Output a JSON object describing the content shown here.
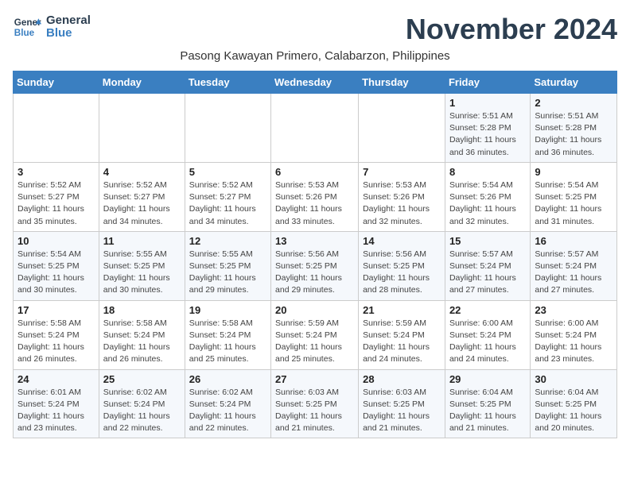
{
  "logo": {
    "line1": "General",
    "line2": "Blue"
  },
  "title": "November 2024",
  "subtitle": "Pasong Kawayan Primero, Calabarzon, Philippines",
  "headers": [
    "Sunday",
    "Monday",
    "Tuesday",
    "Wednesday",
    "Thursday",
    "Friday",
    "Saturday"
  ],
  "weeks": [
    [
      {
        "day": "",
        "info": ""
      },
      {
        "day": "",
        "info": ""
      },
      {
        "day": "",
        "info": ""
      },
      {
        "day": "",
        "info": ""
      },
      {
        "day": "",
        "info": ""
      },
      {
        "day": "1",
        "info": "Sunrise: 5:51 AM\nSunset: 5:28 PM\nDaylight: 11 hours\nand 36 minutes."
      },
      {
        "day": "2",
        "info": "Sunrise: 5:51 AM\nSunset: 5:28 PM\nDaylight: 11 hours\nand 36 minutes."
      }
    ],
    [
      {
        "day": "3",
        "info": "Sunrise: 5:52 AM\nSunset: 5:27 PM\nDaylight: 11 hours\nand 35 minutes."
      },
      {
        "day": "4",
        "info": "Sunrise: 5:52 AM\nSunset: 5:27 PM\nDaylight: 11 hours\nand 34 minutes."
      },
      {
        "day": "5",
        "info": "Sunrise: 5:52 AM\nSunset: 5:27 PM\nDaylight: 11 hours\nand 34 minutes."
      },
      {
        "day": "6",
        "info": "Sunrise: 5:53 AM\nSunset: 5:26 PM\nDaylight: 11 hours\nand 33 minutes."
      },
      {
        "day": "7",
        "info": "Sunrise: 5:53 AM\nSunset: 5:26 PM\nDaylight: 11 hours\nand 32 minutes."
      },
      {
        "day": "8",
        "info": "Sunrise: 5:54 AM\nSunset: 5:26 PM\nDaylight: 11 hours\nand 32 minutes."
      },
      {
        "day": "9",
        "info": "Sunrise: 5:54 AM\nSunset: 5:25 PM\nDaylight: 11 hours\nand 31 minutes."
      }
    ],
    [
      {
        "day": "10",
        "info": "Sunrise: 5:54 AM\nSunset: 5:25 PM\nDaylight: 11 hours\nand 30 minutes."
      },
      {
        "day": "11",
        "info": "Sunrise: 5:55 AM\nSunset: 5:25 PM\nDaylight: 11 hours\nand 30 minutes."
      },
      {
        "day": "12",
        "info": "Sunrise: 5:55 AM\nSunset: 5:25 PM\nDaylight: 11 hours\nand 29 minutes."
      },
      {
        "day": "13",
        "info": "Sunrise: 5:56 AM\nSunset: 5:25 PM\nDaylight: 11 hours\nand 29 minutes."
      },
      {
        "day": "14",
        "info": "Sunrise: 5:56 AM\nSunset: 5:25 PM\nDaylight: 11 hours\nand 28 minutes."
      },
      {
        "day": "15",
        "info": "Sunrise: 5:57 AM\nSunset: 5:24 PM\nDaylight: 11 hours\nand 27 minutes."
      },
      {
        "day": "16",
        "info": "Sunrise: 5:57 AM\nSunset: 5:24 PM\nDaylight: 11 hours\nand 27 minutes."
      }
    ],
    [
      {
        "day": "17",
        "info": "Sunrise: 5:58 AM\nSunset: 5:24 PM\nDaylight: 11 hours\nand 26 minutes."
      },
      {
        "day": "18",
        "info": "Sunrise: 5:58 AM\nSunset: 5:24 PM\nDaylight: 11 hours\nand 26 minutes."
      },
      {
        "day": "19",
        "info": "Sunrise: 5:58 AM\nSunset: 5:24 PM\nDaylight: 11 hours\nand 25 minutes."
      },
      {
        "day": "20",
        "info": "Sunrise: 5:59 AM\nSunset: 5:24 PM\nDaylight: 11 hours\nand 25 minutes."
      },
      {
        "day": "21",
        "info": "Sunrise: 5:59 AM\nSunset: 5:24 PM\nDaylight: 11 hours\nand 24 minutes."
      },
      {
        "day": "22",
        "info": "Sunrise: 6:00 AM\nSunset: 5:24 PM\nDaylight: 11 hours\nand 24 minutes."
      },
      {
        "day": "23",
        "info": "Sunrise: 6:00 AM\nSunset: 5:24 PM\nDaylight: 11 hours\nand 23 minutes."
      }
    ],
    [
      {
        "day": "24",
        "info": "Sunrise: 6:01 AM\nSunset: 5:24 PM\nDaylight: 11 hours\nand 23 minutes."
      },
      {
        "day": "25",
        "info": "Sunrise: 6:02 AM\nSunset: 5:24 PM\nDaylight: 11 hours\nand 22 minutes."
      },
      {
        "day": "26",
        "info": "Sunrise: 6:02 AM\nSunset: 5:24 PM\nDaylight: 11 hours\nand 22 minutes."
      },
      {
        "day": "27",
        "info": "Sunrise: 6:03 AM\nSunset: 5:25 PM\nDaylight: 11 hours\nand 21 minutes."
      },
      {
        "day": "28",
        "info": "Sunrise: 6:03 AM\nSunset: 5:25 PM\nDaylight: 11 hours\nand 21 minutes."
      },
      {
        "day": "29",
        "info": "Sunrise: 6:04 AM\nSunset: 5:25 PM\nDaylight: 11 hours\nand 21 minutes."
      },
      {
        "day": "30",
        "info": "Sunrise: 6:04 AM\nSunset: 5:25 PM\nDaylight: 11 hours\nand 20 minutes."
      }
    ]
  ]
}
